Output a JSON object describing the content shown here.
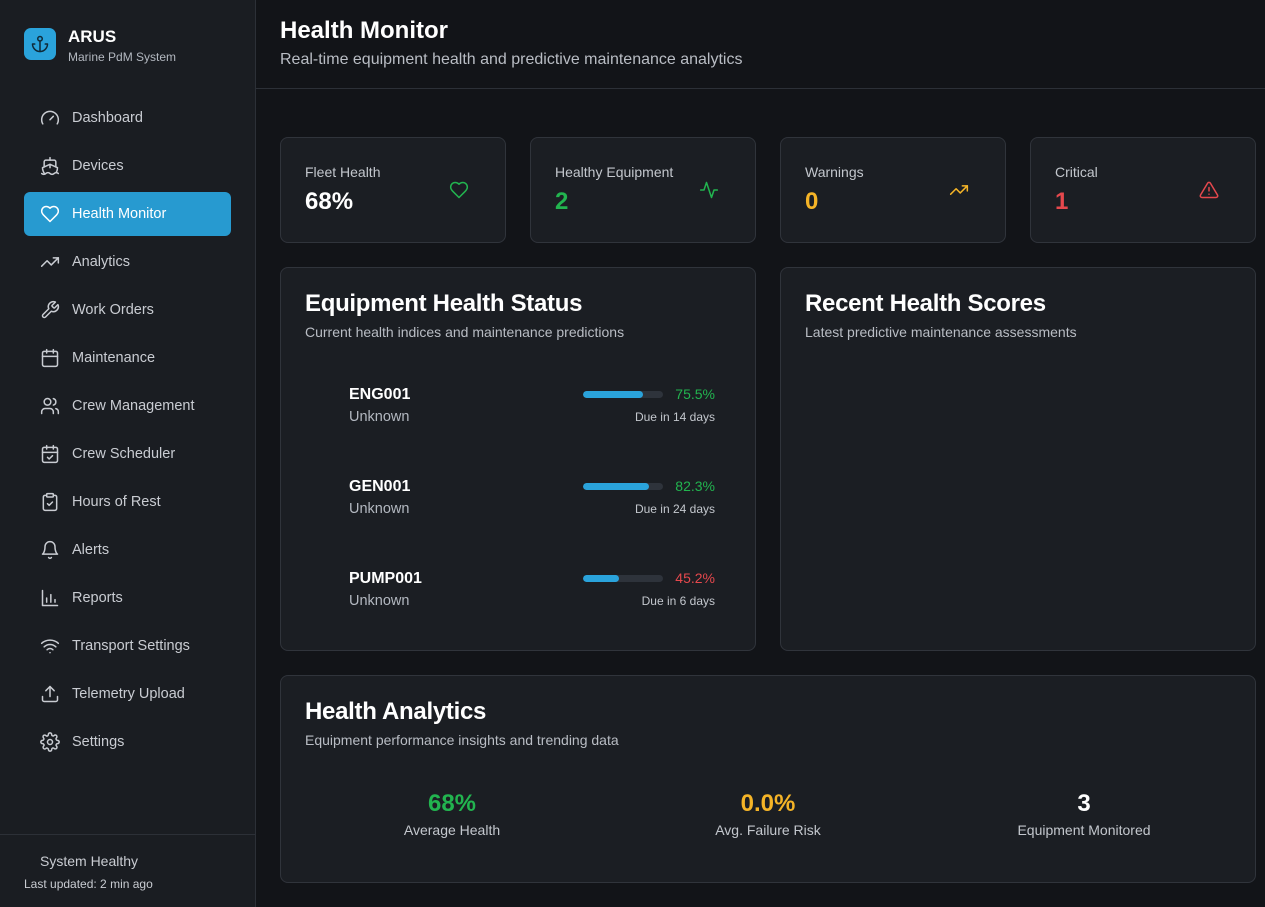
{
  "brand": {
    "name": "ARUS",
    "subtitle": "Marine PdM System"
  },
  "nav": [
    {
      "label": "Dashboard",
      "icon": "gauge-icon"
    },
    {
      "label": "Devices",
      "icon": "ship-icon"
    },
    {
      "label": "Health Monitor",
      "icon": "heart-icon",
      "active": true
    },
    {
      "label": "Analytics",
      "icon": "trending-up-icon"
    },
    {
      "label": "Work Orders",
      "icon": "wrench-icon"
    },
    {
      "label": "Maintenance",
      "icon": "calendar-icon"
    },
    {
      "label": "Crew Management",
      "icon": "users-icon"
    },
    {
      "label": "Crew Scheduler",
      "icon": "calendar-check-icon"
    },
    {
      "label": "Hours of Rest",
      "icon": "clipboard-check-icon"
    },
    {
      "label": "Alerts",
      "icon": "bell-icon"
    },
    {
      "label": "Reports",
      "icon": "bar-chart-icon"
    },
    {
      "label": "Transport Settings",
      "icon": "wifi-icon"
    },
    {
      "label": "Telemetry Upload",
      "icon": "upload-icon"
    },
    {
      "label": "Settings",
      "icon": "gear-icon"
    }
  ],
  "footer": {
    "status": "System Healthy",
    "updated": "Last updated: 2 min ago"
  },
  "header": {
    "title": "Health Monitor",
    "subtitle": "Real-time equipment health and predictive maintenance analytics"
  },
  "stats": [
    {
      "label": "Fleet Health",
      "value": "68%",
      "icon": "heart-icon",
      "color": "#22b44f"
    },
    {
      "label": "Healthy Equipment",
      "value": "2",
      "icon": "activity-icon",
      "color": "#22b44f"
    },
    {
      "label": "Warnings",
      "value": "0",
      "icon": "trending-up-icon",
      "color": "#f5b427"
    },
    {
      "label": "Critical",
      "value": "1",
      "icon": "alert-triangle-icon",
      "color": "#e5484d"
    }
  ],
  "equipment_status": {
    "title": "Equipment Health Status",
    "subtitle": "Current health indices and maintenance predictions",
    "items": [
      {
        "id": "ENG001",
        "type": "Unknown",
        "health": 75.5,
        "health_label": "75.5%",
        "due": "Due in 14 days",
        "status": "good"
      },
      {
        "id": "GEN001",
        "type": "Unknown",
        "health": 82.3,
        "health_label": "82.3%",
        "due": "Due in 24 days",
        "status": "good"
      },
      {
        "id": "PUMP001",
        "type": "Unknown",
        "health": 45.2,
        "health_label": "45.2%",
        "due": "Due in 6 days",
        "status": "critical"
      }
    ]
  },
  "recent_scores": {
    "title": "Recent Health Scores",
    "subtitle": "Latest predictive maintenance assessments"
  },
  "analytics": {
    "title": "Health Analytics",
    "subtitle": "Equipment performance insights and trending data",
    "metrics": [
      {
        "value": "68%",
        "label": "Average Health",
        "color": "#22b44f"
      },
      {
        "value": "0.0%",
        "label": "Avg. Failure Risk",
        "color": "#f5b427"
      },
      {
        "value": "3",
        "label": "Equipment Monitored",
        "color": "#ffffff"
      }
    ]
  }
}
